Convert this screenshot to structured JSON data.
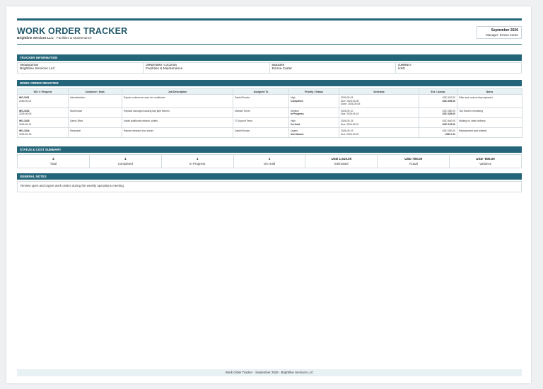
{
  "header": {
    "title": "WORK ORDER TRACKER",
    "company": "Brightline Services LLC",
    "subtitle_rest": " · Facilities & Maintenance",
    "month": "September 2026",
    "manager": "Manager: Emma Carter"
  },
  "tracker_info": {
    "section_title": "TRACKER INFORMATION",
    "fields": [
      {
        "label": "ORGANIZATION",
        "value": "Brightline Services LLC"
      },
      {
        "label": "DEPARTMENT / LOCATION",
        "value": "Facilities & Maintenance"
      },
      {
        "label": "MANAGER",
        "value": "Emma Carter"
      },
      {
        "label": "CURRENCY",
        "value": "USD"
      }
    ]
  },
  "register": {
    "section_title": "WORK ORDER REGISTER",
    "columns": [
      "WO # / Request",
      "Customer / Dept.",
      "Job Description",
      "Assigned To",
      "Priority / Status",
      "Schedule",
      "Est. / Actual",
      "Notes"
    ],
    "rows": [
      {
        "wo": "WO-1021",
        "date": "2026-09-01",
        "customer": "Administration",
        "job": "Repair conference room air conditioner",
        "assigned": "Daniel Brooks",
        "priority": "High",
        "status": "Completed",
        "sched1": "2026-09-03",
        "sched2": "Due: 2026-09-06",
        "sched3": "Done: 2026-09-05",
        "est": "USD 420.00",
        "actual": "USD 395.00",
        "notes": "Filter and control relay replaced"
      },
      {
        "wo": "WO-1022",
        "date": "2026-09-05",
        "customer": "Warehouse",
        "job": "Replace damaged loading bay light fixtures",
        "assigned": "Michael Torres",
        "priority": "Medium",
        "status": "In Progress",
        "sched1": "2026-09-10",
        "sched2": "Due: 2026-09-18",
        "sched3": "",
        "est": "USD 380.00",
        "actual": "USD 185.00",
        "notes": "Two fixtures remaining"
      },
      {
        "wo": "WO-1023",
        "date": "2026-09-12",
        "customer": "Sales Office",
        "job": "Install additional network outlets",
        "assigned": "IT Support Team",
        "priority": "High",
        "status": "On Hold",
        "sched1": "2026-09-15",
        "sched2": "Due: 2026-09-22",
        "sched3": "",
        "est": "USD 460.00",
        "actual": "USD 125.00",
        "notes": "Waiting for cable delivery"
      },
      {
        "wo": "WO-1024",
        "date": "2026-09-18",
        "customer": "Reception",
        "job": "Repair entrance door closer",
        "assigned": "Daniel Brooks",
        "priority": "Urgent",
        "status": "Not Started",
        "sched1": "2026-09-19",
        "sched2": "Due: 2026-09-20",
        "sched3": "",
        "est": "USD 250.00",
        "actual": "USD 0.00",
        "notes": "Replacement part ordered"
      }
    ]
  },
  "summary": {
    "section_title": "STATUS & COST SUMMARY",
    "cells": [
      {
        "value": "4",
        "label": "Total"
      },
      {
        "value": "1",
        "label": "Completed"
      },
      {
        "value": "1",
        "label": "In Progress"
      },
      {
        "value": "1",
        "label": "On Hold"
      },
      {
        "value": "USD 1,510.00",
        "label": "Estimated"
      },
      {
        "value": "USD 705.00",
        "label": "Actual"
      },
      {
        "value": "USD -805.00",
        "label": "Variance"
      }
    ]
  },
  "notes": {
    "section_title": "GENERAL NOTES",
    "text": "Review open and urgent work orders during the weekly operations meeting."
  },
  "footer": {
    "text": "Work Order Tracker · September 2026 · Brightline Services LLC"
  },
  "colors": {
    "accent": "#246579",
    "header_fill": "#e8f1f4"
  }
}
